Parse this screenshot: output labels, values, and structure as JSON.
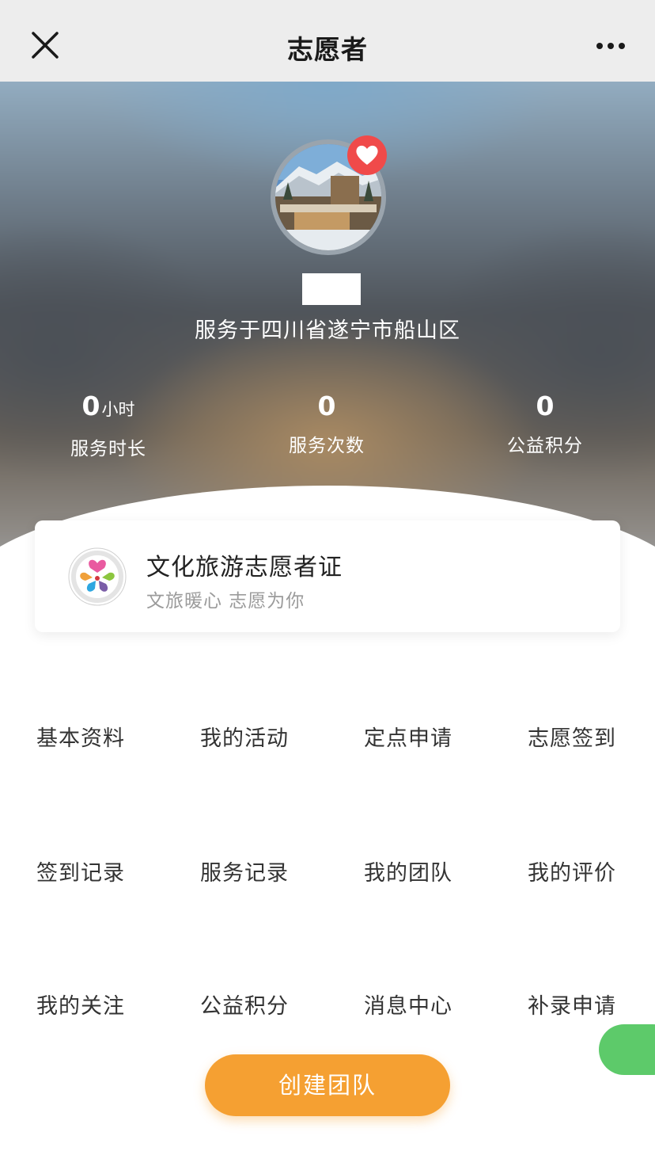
{
  "titlebar": {
    "title": "志愿者",
    "close_icon": "close-icon",
    "more_icon": "more-icon"
  },
  "profile": {
    "avatar_icon": "avatar",
    "badge_icon": "heart-icon",
    "service_area": "服务于四川省遂宁市船山区"
  },
  "stats": [
    {
      "value": "0",
      "unit": "小时",
      "label": "服务时长"
    },
    {
      "value": "0",
      "unit": "",
      "label": "服务次数"
    },
    {
      "value": "0",
      "unit": "",
      "label": "公益积分"
    }
  ],
  "certificate": {
    "title": "文化旅游志愿者证",
    "subtitle": "文旅暖心 志愿为你",
    "logo_icon": "volunteer-logo-icon"
  },
  "menu": [
    "基本资料",
    "我的活动",
    "定点申请",
    "志愿签到",
    "签到记录",
    "服务记录",
    "我的团队",
    "我的评价",
    "我的关注",
    "公益积分",
    "消息中心",
    "补录申请"
  ],
  "create_team_label": "创建团队",
  "colors": {
    "accent_orange": "#f5a032",
    "accent_green": "#5dca6a",
    "heart_red": "#f04a4a",
    "titlebar_bg": "#ededed"
  }
}
